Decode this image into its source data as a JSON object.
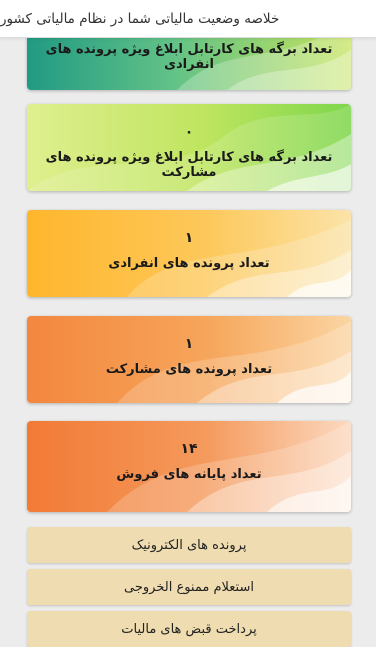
{
  "header": {
    "title": "خلاصه وضعیت مالیاتی شما در نظام مالیاتی کشور"
  },
  "cards": [
    {
      "value": "",
      "label": "تعداد برگه های کارتابل ابلاغ ویژه پرونده های انفرادی"
    },
    {
      "value": "۰",
      "label": "تعداد برگه های کارتابل ابلاغ ویژه پرونده های مشارکت"
    },
    {
      "value": "۱",
      "label": "تعداد پرونده های انفرادی"
    },
    {
      "value": "۱",
      "label": "تعداد پرونده های مشارکت"
    },
    {
      "value": "۱۴",
      "label": "تعداد پایانه های فروش"
    }
  ],
  "menu": [
    {
      "label": "پرونده های الکترونیک"
    },
    {
      "label": "استعلام ممنوع الخروجی"
    },
    {
      "label": "پرداخت قبض های مالیات"
    }
  ]
}
